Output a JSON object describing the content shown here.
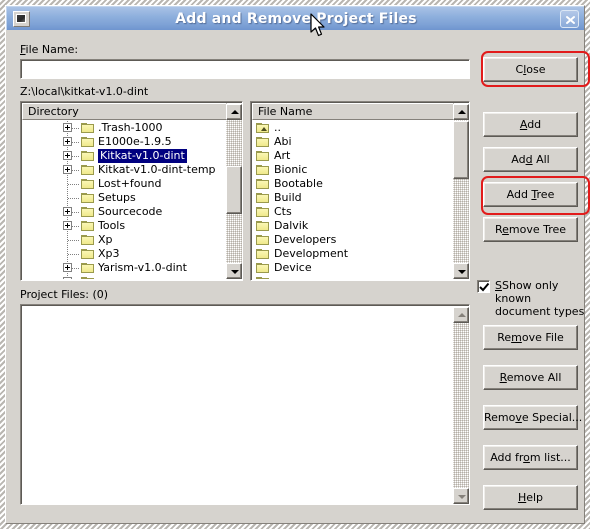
{
  "window": {
    "title": "Add and Remove Project Files",
    "sysmenu_icon": "window-menu-icon",
    "close_icon": "close-icon"
  },
  "form": {
    "file_name_label": "File Name:",
    "file_name_mnemonic": "F",
    "file_name_value": "",
    "current_path": "Z:\\local\\kitkat-v1.0-dint",
    "project_files_label": "Project Files: (0)",
    "project_files_items": []
  },
  "directory_panel": {
    "header": "Directory",
    "items": [
      {
        "label": ".Trash-1000",
        "expandable": true,
        "selected": false,
        "indent": 2
      },
      {
        "label": "E1000e-1.9.5",
        "expandable": true,
        "selected": false,
        "indent": 2
      },
      {
        "label": "Kitkat-v1.0-dint",
        "expandable": true,
        "selected": true,
        "indent": 2
      },
      {
        "label": "Kitkat-v1.0-dint-temp",
        "expandable": true,
        "selected": false,
        "indent": 2
      },
      {
        "label": "Lost+found",
        "expandable": false,
        "selected": false,
        "indent": 2
      },
      {
        "label": "Setups",
        "expandable": false,
        "selected": false,
        "indent": 2
      },
      {
        "label": "Sourcecode",
        "expandable": true,
        "selected": false,
        "indent": 2
      },
      {
        "label": "Tools",
        "expandable": true,
        "selected": false,
        "indent": 2
      },
      {
        "label": "Xp",
        "expandable": false,
        "selected": false,
        "indent": 2
      },
      {
        "label": "Xp3",
        "expandable": false,
        "selected": false,
        "indent": 2
      },
      {
        "label": "Yarism-v1.0-dint",
        "expandable": true,
        "selected": false,
        "indent": 2
      }
    ]
  },
  "file_panel": {
    "header": "File Name",
    "items": [
      {
        "label": "..",
        "icon": "folder-up-icon"
      },
      {
        "label": "Abi",
        "icon": "folder-icon"
      },
      {
        "label": "Art",
        "icon": "folder-icon"
      },
      {
        "label": "Bionic",
        "icon": "folder-icon"
      },
      {
        "label": "Bootable",
        "icon": "folder-icon"
      },
      {
        "label": "Build",
        "icon": "folder-icon"
      },
      {
        "label": "Cts",
        "icon": "folder-icon"
      },
      {
        "label": "Dalvik",
        "icon": "folder-icon"
      },
      {
        "label": "Developers",
        "icon": "folder-icon"
      },
      {
        "label": "Development",
        "icon": "folder-icon"
      },
      {
        "label": "Device",
        "icon": "folder-icon"
      }
    ]
  },
  "buttons": {
    "close": "Close",
    "add": "Add",
    "add_all": "Add All",
    "add_tree": "Add Tree",
    "remove_tree": "Remove Tree",
    "remove_file": "Remove File",
    "remove_all": "Remove All",
    "remove_special": "Remove Special...",
    "add_from_list": "Add from list...",
    "help": "Help"
  },
  "checkbox": {
    "line1": "Show only known",
    "line2": "document types",
    "checked": true
  },
  "annotations": {
    "color": "#e21b1b",
    "targets": [
      "Close",
      "Add Tree"
    ]
  }
}
